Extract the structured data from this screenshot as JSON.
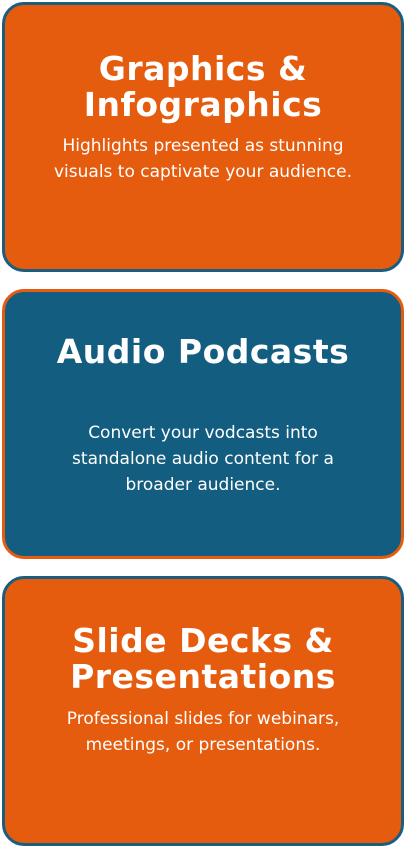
{
  "cards": [
    {
      "title_line1": "Graphics &",
      "title_line2": "Infographics",
      "desc_line1": "Highlights presented as stunning",
      "desc_line2": "visuals to captivate your audience."
    },
    {
      "title_line1": "Audio Podcasts",
      "desc_line1": "Convert your vodcasts into",
      "desc_line2": "standalone audio content for a",
      "desc_line3": "broader audience."
    },
    {
      "title_line1": "Slide Decks &",
      "title_line2": "Presentations",
      "desc_line1": "Professional slides for webinars,",
      "desc_line2": "meetings, or presentations."
    }
  ],
  "colors": {
    "orange": "#e55c0f",
    "blue": "#135e80",
    "text": "#ffffff"
  }
}
